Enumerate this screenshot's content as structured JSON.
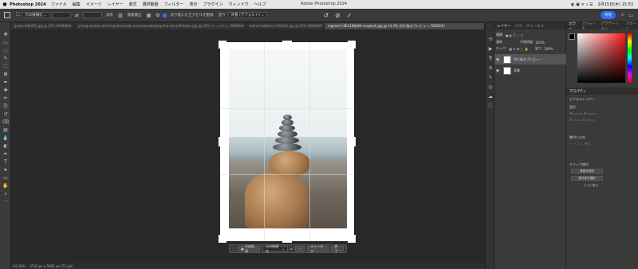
{
  "menubar": {
    "apple": "",
    "app": "Photoshop 2024",
    "items": [
      "ファイル",
      "編集",
      "イメージ",
      "レイヤー",
      "書式",
      "選択範囲",
      "フィルター",
      "表示",
      "プラグイン",
      "ウィンドウ",
      "ヘルプ"
    ],
    "center_title": "Adobe Photoshop 2024",
    "clock": "2月15日(木) 15:53"
  },
  "optbar": {
    "ratio_label": "元の縦横比",
    "clear_label": "消去",
    "straighten_label": "角度補正",
    "delete_pixels_label": "切り抜いたピクセルを削除",
    "fill_label": "塗り",
    "fill_value": "背景 (デフォルト)",
    "share_label": "共有"
  },
  "tabs": [
    {
      "label": "guitar-944261.jpg @ 25% (RGB/8#)",
      "active": false
    },
    {
      "label": "young-woman-drinking-lemonade-and-eavesdroping-the-city-jeffeleton.jpg @ 25% (ヘッドホン, RGB/8#)",
      "active": false
    },
    {
      "label": "hot-air-balloon-1300341.jpg @ 25% (RGB/8#)",
      "active": false
    },
    {
      "label": "ingmar-h-8K14N0jtNi-unsplash.jpg @ 14.3% (切り抜きプレビュー, RGB/8#)",
      "active": true
    }
  ],
  "tools": [
    "move-icon",
    "artboard-icon",
    "lasso-icon",
    "quick-select-icon",
    "crop-icon",
    "frame-icon",
    "eyedropper-icon",
    "healing-icon",
    "brush-icon",
    "stamp-icon",
    "history-brush-icon",
    "eraser-icon",
    "gradient-icon",
    "blur-icon",
    "dodge-icon",
    "pen-icon",
    "type-icon",
    "path-select-icon",
    "shape-icon",
    "hand-icon",
    "zoom-icon",
    "more-icon"
  ],
  "tool_glyphs": [
    "✥",
    "▭",
    "◌",
    "✎",
    "⛶",
    "⊠",
    "✒",
    "✚",
    "✏",
    "⎘",
    "↺",
    "⌫",
    "▤",
    "💧",
    "◐",
    "✒",
    "T",
    "➤",
    "▭",
    "✋",
    "⌕",
    "···"
  ],
  "ctxbar": {
    "generative_fill": "生成拡張",
    "ratio": "元の縦横比",
    "more": "···",
    "cancel": "キャンセル",
    "done": "完了"
  },
  "status": {
    "zoom": "14.32%",
    "doc_info": "3734 px x 5602 px (72 ppi)"
  },
  "layers_panel": {
    "tabs": [
      "レイヤー",
      "パス",
      "チャンネル"
    ],
    "kind_label": "種類",
    "blend_label": "通常",
    "opacity_label": "不透明度:",
    "opacity_value": "100%",
    "lock_label": "ロック:",
    "fill_label": "塗り:",
    "fill_value": "100%",
    "layers": [
      {
        "name": "切り抜きプレビュー",
        "selected": true
      },
      {
        "name": "背景",
        "selected": false
      }
    ]
  },
  "right_panel": {
    "color_tabs": [
      "カラー",
      "スウォッチ",
      "グラデーション",
      "パターン"
    ],
    "props_tab": "プロパティ",
    "props_type": "ピクセルレイヤー",
    "transform_label": "変形",
    "align_label": "整列と分布",
    "quick_actions_label": "クイック操作",
    "btn_remove_bg": "背景を削除",
    "btn_select_subject": "被写体を選択",
    "more_link": "さらに表示"
  },
  "colors": {
    "accent": "#2f6ef0",
    "panel": "#3a3a3a",
    "canvas": "#282828"
  }
}
